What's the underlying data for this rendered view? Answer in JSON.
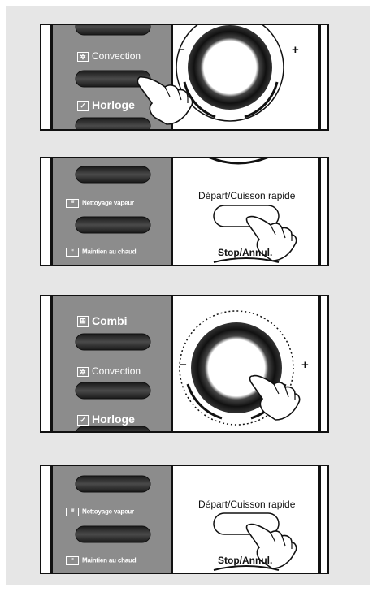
{
  "panel1": {
    "convection_label": "Convection",
    "horloge_label": "Horloge",
    "minus": "−",
    "plus": "+"
  },
  "panel2": {
    "nettoyage_label": "Nettoyage vapeur",
    "maintien_label": "Maintien au chaud",
    "start_label": "Départ/Cuisson rapide",
    "stop_label": "Stop/Annul."
  },
  "panel3": {
    "combi_label": "Combi",
    "convection_label": "Convection",
    "horloge_label": "Horloge",
    "minus": "−",
    "plus": "+"
  },
  "panel4": {
    "nettoyage_label": "Nettoyage vapeur",
    "maintien_label": "Maintien au chaud",
    "start_label": "Départ/Cuisson rapide",
    "stop_label": "Stop/Annul."
  },
  "colors": {
    "left_strip": "#8c8c8c",
    "button_dark": "#2e2e2e",
    "outline": "#111111",
    "backdrop": "#e6e6e6"
  },
  "icons": [
    "convection-icon",
    "clock-icon",
    "steam-clean-icon",
    "keep-warm-icon",
    "combi-icon",
    "pointing-hand-icon",
    "dial-knob"
  ]
}
